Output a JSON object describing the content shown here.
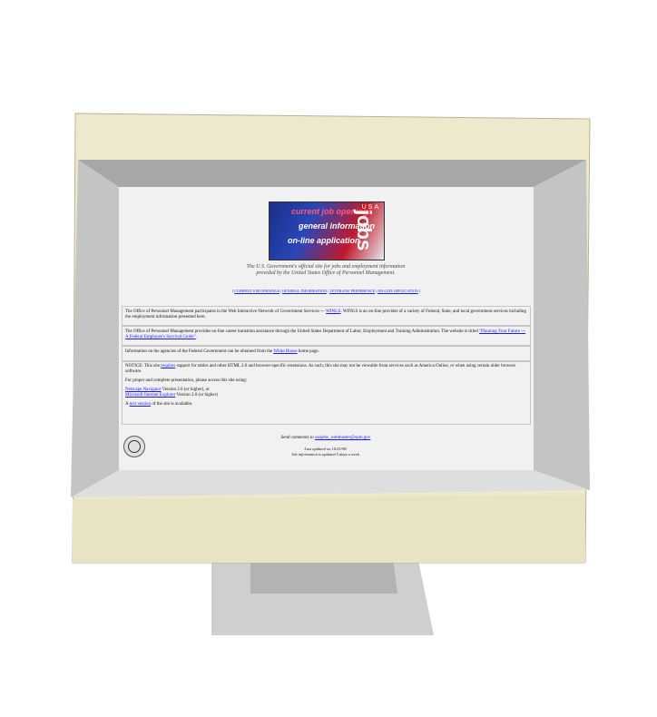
{
  "banner": {
    "line1": "current job openings",
    "line2": "general information",
    "line3": "on-line application",
    "usa": "USA",
    "jobs": "jobs"
  },
  "tagline": {
    "line1": "The U.S. Government's official site for jobs and employment information",
    "line2": "provided by the United States Office of Personnel Management."
  },
  "nav": {
    "open": "[",
    "items": [
      "CURRENT JOB OPENINGS",
      "GENERAL INFORMATION",
      "VETERANS' PREFERENCE",
      "ON-LINE APPLICATION"
    ],
    "sep": "|",
    "close": "]"
  },
  "para1": {
    "before": "The Office of Personnel Management participates in the Web Interactive Network of Government Services --- ",
    "link": "WINGS",
    "after": ". WINGS is an on-line provider of a variety of Federal, State, and local government services including the employment information presented here."
  },
  "para2": {
    "before": "The Office of Personnel Management provides on-line career transition assistance through the United States Department of Labor, Employment and Training Administration. The website is titled ",
    "link": "\"Planning Your Future --- A Federal Employee's Survival Guide\"",
    "after": "."
  },
  "para3": {
    "before": "Information on the agencies of the Federal Government can be obtained from the ",
    "link": "White House",
    "after": " home page."
  },
  "para4": {
    "before": "NOTICE: This site ",
    "link": "requires",
    "after": " support for tables and other HTML 2.0 and browser-specific extensions. As such, this site may not be viewable from services such as America Online, or when using certain older browser software."
  },
  "para5": {
    "text": "For proper and complete presentation, please access this site using:"
  },
  "browsers": {
    "netscape_link": "Netscape Navigator",
    "netscape_after": " Version 2.0 (or higher), or",
    "ie_link": "Microsoft Internet Explorer",
    "ie_after": " Version 2.0 (or higher)"
  },
  "textversion": {
    "before": "A ",
    "link": "text version",
    "after": " of the site is available."
  },
  "footer": {
    "comments_before": "Send comments to ",
    "comments_link": "usajobs_webmaster@opm.gov",
    "updated": "Last updated on 10/21/98.",
    "schedule": "Job information is updated 5 days a week."
  },
  "colors": {
    "bezel": "#eee9cc",
    "bezel_shadow": "#d6d0a9",
    "inner_top": "#a7a7a7",
    "inner_side": "#c4c4c4",
    "screen": "#f1f1f1",
    "link": "#1a1aee"
  }
}
